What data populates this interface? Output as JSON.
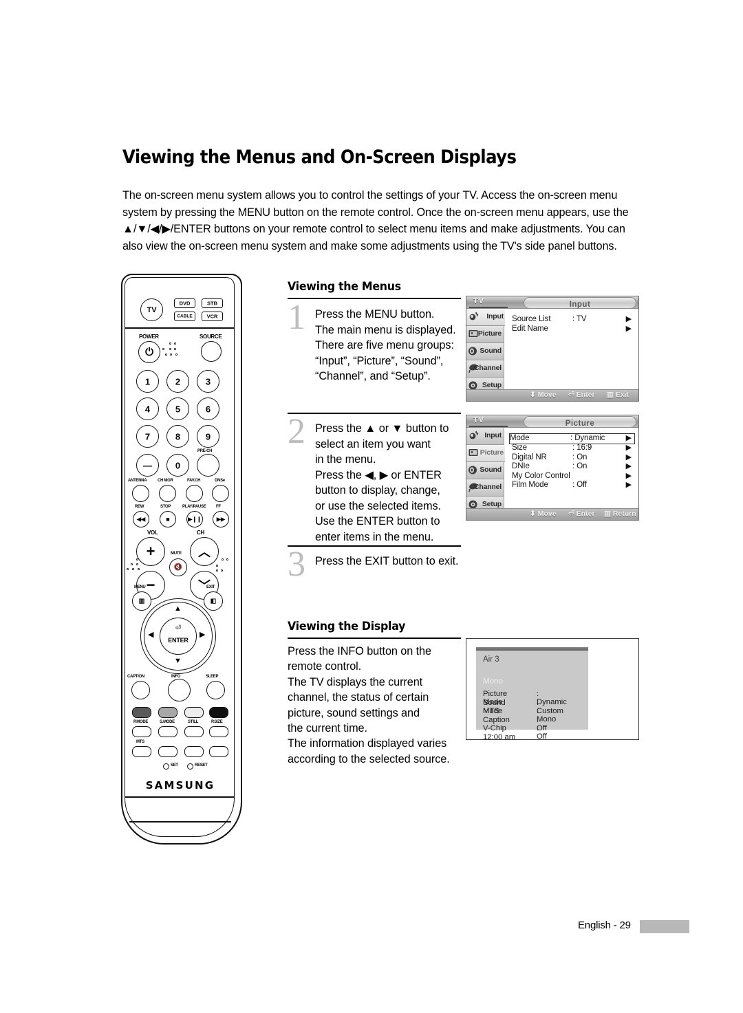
{
  "page": {
    "title": "Viewing the Menus and On-Screen Displays",
    "intro": "The on-screen menu system allows you to control the settings of your TV. Access the on-screen menu system by pressing the MENU button on the remote control. Once the on-screen menu appears, use the ▲/▼/◀/▶/ENTER buttons on your remote control to select menu items and make adjustments. You can also view the on-screen menu system and make some adjustments using the TV's side panel buttons.",
    "footer_label": "English - 29"
  },
  "sections": {
    "menus_heading": "Viewing the Menus",
    "display_heading": "Viewing the Display"
  },
  "steps": [
    {
      "number": "1",
      "text": "Press the MENU button.\nThe main menu is displayed.\nThere are five menu groups:\n“Input”, “Picture”, “Sound”,\n“Channel”, and “Setup”."
    },
    {
      "number": "2",
      "text": "Press the ▲ or ▼ button to\nselect an item you want\nin the menu.\nPress the ◀, ▶ or ENTER\nbutton to display, change,\nor use the selected items.\nUse the ENTER button to\nenter items in the menu."
    },
    {
      "number": "3",
      "text": "Press the EXIT button to exit."
    }
  ],
  "display_text": "Press the INFO button on the\nremote control.\nThe TV displays the current\nchannel, the status of certain\npicture, sound settings and\nthe current time.\nThe information displayed varies\naccording to the selected source.",
  "osd_input": {
    "source_label": "TV",
    "title": "Input",
    "sidebar": [
      {
        "label": "Input",
        "icon": "input-icon",
        "active": true
      },
      {
        "label": "Picture",
        "icon": "picture-icon",
        "active": false
      },
      {
        "label": "Sound",
        "icon": "sound-icon",
        "active": false
      },
      {
        "label": "Channel",
        "icon": "channel-icon",
        "active": false
      },
      {
        "label": "Setup",
        "icon": "setup-icon",
        "active": false
      }
    ],
    "rows": [
      {
        "label": "Source List",
        "value": ": TV",
        "arrow": "▶",
        "selected": false
      },
      {
        "label": "Edit Name",
        "value": "",
        "arrow": "▶",
        "selected": false
      }
    ],
    "footer": [
      {
        "icon": "updown-icon",
        "label": "Move"
      },
      {
        "icon": "enter-icon",
        "label": "Enter"
      },
      {
        "icon": "menu-icon",
        "label": "Exit"
      }
    ]
  },
  "osd_picture": {
    "source_label": "TV",
    "title": "Picture",
    "sidebar": [
      {
        "label": "Input",
        "icon": "input-icon",
        "active": false
      },
      {
        "label": "Picture",
        "icon": "picture-icon",
        "active": true
      },
      {
        "label": "Sound",
        "icon": "sound-icon",
        "active": false
      },
      {
        "label": "Channel",
        "icon": "channel-icon",
        "active": false
      },
      {
        "label": "Setup",
        "icon": "setup-icon",
        "active": false
      }
    ],
    "rows": [
      {
        "label": "Mode",
        "value": ": Dynamic",
        "arrow": "▶",
        "selected": true
      },
      {
        "label": "Size",
        "value": ": 16:9",
        "arrow": "▶",
        "selected": false
      },
      {
        "label": "Digital NR",
        "value": ": On",
        "arrow": "▶",
        "selected": false
      },
      {
        "label": "DNIe",
        "value": ": On",
        "arrow": "▶",
        "selected": false
      },
      {
        "label": "My Color Control",
        "value": "",
        "arrow": "▶",
        "selected": false
      },
      {
        "label": "Film Mode",
        "value": ": Off",
        "arrow": "▶",
        "selected": false
      }
    ],
    "footer": [
      {
        "icon": "updown-icon",
        "label": "Move"
      },
      {
        "icon": "enter-icon",
        "label": "Enter"
      },
      {
        "icon": "menu-icon",
        "label": "Return"
      }
    ]
  },
  "info_display": {
    "channel": "Air 3",
    "audio": "Mono",
    "rows": [
      {
        "label": "Picture Mode",
        "value": ": Dynamic"
      },
      {
        "label": "Sound Mode",
        "value": ": Custom"
      },
      {
        "label": "MTS",
        "value": ": Mono"
      },
      {
        "label": "Caption",
        "value": ": Off"
      },
      {
        "label": "V-Chip",
        "value": ": Off"
      }
    ],
    "time": "12:00 am"
  },
  "remote": {
    "brand": "SAMSUNG",
    "device_buttons": [
      {
        "label": "TV",
        "shape": "circle"
      },
      {
        "label": "DVD",
        "shape": "rect"
      },
      {
        "label": "STB",
        "shape": "rect"
      },
      {
        "label": "CABLE",
        "shape": "rect"
      },
      {
        "label": "VCR",
        "shape": "rect"
      }
    ],
    "power_label": "POWER",
    "source_label": "SOURCE",
    "numbers": [
      "1",
      "2",
      "3",
      "4",
      "5",
      "6",
      "7",
      "8",
      "9",
      "—",
      "0"
    ],
    "prech_label": "PRE-CH",
    "function_row": [
      "ANTENNA",
      "CH MGR",
      "FAV.CH",
      "DNSe"
    ],
    "transport_row": [
      "REW",
      "STOP",
      "PLAY/PAUSE",
      "FF"
    ],
    "vol_label": "VOL",
    "ch_label": "CH",
    "mute_label": "MUTE",
    "menu_label": "MENU",
    "exit_label": "EXIT",
    "enter_label": "ENTER",
    "bottom_row": [
      "CAPTION",
      "INFO",
      "SLEEP"
    ],
    "mode_row": [
      "P.MODE",
      "S.MODE",
      "STILL",
      "P.SIZE"
    ],
    "mts_label": "MTS",
    "set_label": "SET",
    "reset_label": "RESET"
  },
  "colors": {
    "step_number": "#bdbdbd",
    "osd_panel": "#c9c9c9",
    "footer_block": "#b8b8b8"
  }
}
